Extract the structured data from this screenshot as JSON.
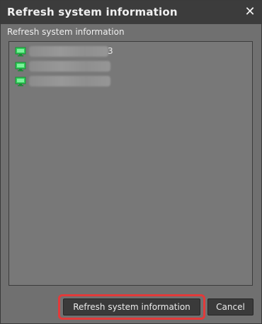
{
  "window": {
    "title": "Refresh system information",
    "close_glyph": "✕"
  },
  "dialog": {
    "subtitle": "Refresh system information"
  },
  "system_list": {
    "items": [
      {
        "icon": "computer-icon",
        "label_visible": false
      },
      {
        "icon": "computer-icon",
        "label_visible": false
      },
      {
        "icon": "computer-icon",
        "label_visible": false
      }
    ],
    "first_item_trailing_glyph": "3"
  },
  "buttons": {
    "refresh_label": "Refresh system information",
    "cancel_label": "Cancel"
  },
  "colors": {
    "titlebar": "#3c3c3c",
    "dialog_bg": "#707070",
    "highlight": "#e23a3a",
    "computer_icon": "#2fd05a"
  }
}
